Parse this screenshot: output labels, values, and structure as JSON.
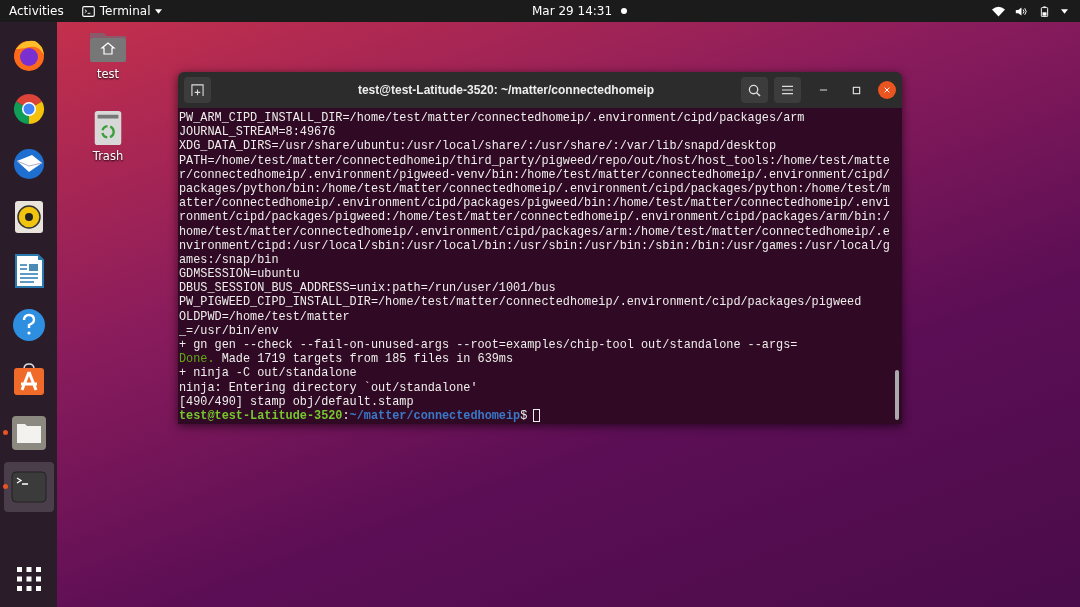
{
  "top_bar": {
    "activities": "Activities",
    "app_menu": {
      "label": "Terminal"
    },
    "clock": "Mar 29  14:31",
    "notification_dot": true
  },
  "dock": {
    "items": [
      {
        "kind": "firefox",
        "running": false,
        "selected": false
      },
      {
        "kind": "chrome",
        "running": false,
        "selected": false
      },
      {
        "kind": "thunderbird",
        "running": false,
        "selected": false
      },
      {
        "kind": "rhythmbox",
        "running": false,
        "selected": false
      },
      {
        "kind": "writer",
        "running": false,
        "selected": false
      },
      {
        "kind": "help",
        "running": false,
        "selected": false
      },
      {
        "kind": "software",
        "running": false,
        "selected": false
      },
      {
        "kind": "files",
        "running": true,
        "selected": false
      },
      {
        "kind": "terminal",
        "running": true,
        "selected": true
      }
    ]
  },
  "desktop_icons": [
    {
      "kind": "home",
      "label": "test"
    },
    {
      "kind": "trash",
      "label": "Trash"
    }
  ],
  "window": {
    "title": "test@test-Latitude-3520: ~/matter/connectedhomeip",
    "lines": [
      {
        "kind": "plain",
        "text": "PW_ARM_CIPD_INSTALL_DIR=/home/test/matter/connectedhomeip/.environment/cipd/packages/arm"
      },
      {
        "kind": "plain",
        "text": "JOURNAL_STREAM=8:49676"
      },
      {
        "kind": "plain",
        "text": "XDG_DATA_DIRS=/usr/share/ubuntu:/usr/local/share/:/usr/share/:/var/lib/snapd/desktop"
      },
      {
        "kind": "plain",
        "text": "PATH=/home/test/matter/connectedhomeip/third_party/pigweed/repo/out/host/host_tools:/home/test/matte"
      },
      {
        "kind": "plain",
        "text": "r/connectedhomeip/.environment/pigweed-venv/bin:/home/test/matter/connectedhomeip/.environment/cipd/"
      },
      {
        "kind": "plain",
        "text": "packages/python/bin:/home/test/matter/connectedhomeip/.environment/cipd/packages/python:/home/test/m"
      },
      {
        "kind": "plain",
        "text": "atter/connectedhomeip/.environment/cipd/packages/pigweed/bin:/home/test/matter/connectedhomeip/.envi"
      },
      {
        "kind": "plain",
        "text": "ronment/cipd/packages/pigweed:/home/test/matter/connectedhomeip/.environment/cipd/packages/arm/bin:/"
      },
      {
        "kind": "plain",
        "text": "home/test/matter/connectedhomeip/.environment/cipd/packages/arm:/home/test/matter/connectedhomeip/.e"
      },
      {
        "kind": "plain",
        "text": "nvironment/cipd:/usr/local/sbin:/usr/local/bin:/usr/sbin:/usr/bin:/sbin:/bin:/usr/games:/usr/local/g"
      },
      {
        "kind": "plain",
        "text": "ames:/snap/bin"
      },
      {
        "kind": "plain",
        "text": "GDMSESSION=ubuntu"
      },
      {
        "kind": "plain",
        "text": "DBUS_SESSION_BUS_ADDRESS=unix:path=/run/user/1001/bus"
      },
      {
        "kind": "plain",
        "text": "PW_PIGWEED_CIPD_INSTALL_DIR=/home/test/matter/connectedhomeip/.environment/cipd/packages/pigweed"
      },
      {
        "kind": "plain",
        "text": "OLDPWD=/home/test/matter"
      },
      {
        "kind": "plain",
        "text": "_=/usr/bin/env"
      },
      {
        "kind": "plain",
        "text": "+ gn gen --check --fail-on-unused-args --root=examples/chip-tool out/standalone --args="
      },
      {
        "kind": "status",
        "status": "Done.",
        "text": " Made 1719 targets from 185 files in 639ms"
      },
      {
        "kind": "plain",
        "text": "+ ninja -C out/standalone"
      },
      {
        "kind": "plain",
        "text": "ninja: Entering directory `out/standalone'"
      },
      {
        "kind": "plain",
        "text": "[490/490] stamp obj/default.stamp"
      }
    ],
    "prompt": {
      "user_host": "test@test-Latitude-3520",
      "separator": ":",
      "path": "~/matter/connectedhomeip",
      "symbol": "$"
    }
  }
}
